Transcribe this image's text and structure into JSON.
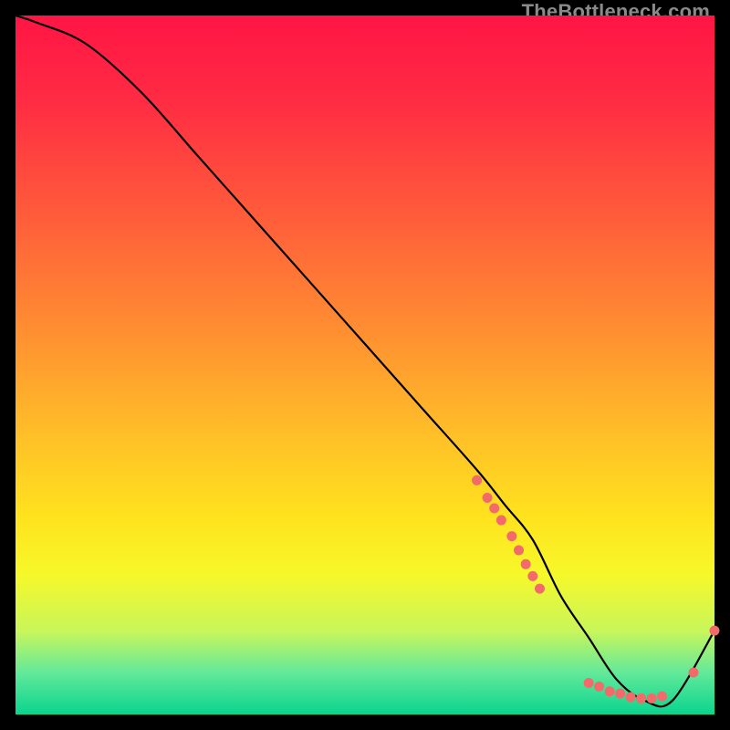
{
  "watermark": "TheBottleneck.com",
  "chart_data": {
    "type": "line",
    "title": "",
    "xlabel": "",
    "ylabel": "",
    "xlim": [
      0,
      100
    ],
    "ylim": [
      0,
      100
    ],
    "line": {
      "x": [
        0,
        3,
        10,
        18,
        26,
        34,
        42,
        50,
        58,
        66,
        70,
        74,
        78,
        82,
        86,
        90,
        94,
        100
      ],
      "y": [
        100,
        99,
        96,
        89,
        80,
        71,
        62,
        53,
        44,
        35,
        30,
        25,
        17,
        11,
        5,
        2,
        2,
        12
      ]
    },
    "markers": [
      {
        "x": 66.0,
        "y": 33.5
      },
      {
        "x": 67.5,
        "y": 31.0
      },
      {
        "x": 68.5,
        "y": 29.5
      },
      {
        "x": 69.5,
        "y": 27.8
      },
      {
        "x": 71.0,
        "y": 25.5
      },
      {
        "x": 72.0,
        "y": 23.5
      },
      {
        "x": 73.0,
        "y": 21.5
      },
      {
        "x": 74.0,
        "y": 19.8
      },
      {
        "x": 75.0,
        "y": 18.0
      },
      {
        "x": 82.0,
        "y": 4.5
      },
      {
        "x": 83.5,
        "y": 4.0
      },
      {
        "x": 85.0,
        "y": 3.3
      },
      {
        "x": 86.5,
        "y": 3.0
      },
      {
        "x": 88.0,
        "y": 2.5
      },
      {
        "x": 89.5,
        "y": 2.3
      },
      {
        "x": 91.0,
        "y": 2.3
      },
      {
        "x": 92.5,
        "y": 2.6
      },
      {
        "x": 97.0,
        "y": 6.0
      },
      {
        "x": 100.0,
        "y": 12.0
      }
    ],
    "marker_color": "#f26a6a",
    "line_color": "#000000"
  }
}
